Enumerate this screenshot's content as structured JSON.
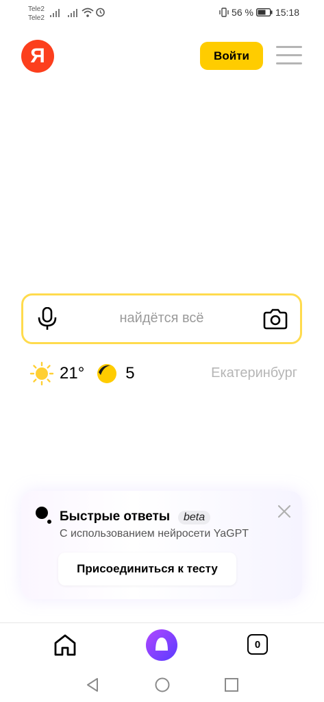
{
  "status_bar": {
    "carrier_1": "Tele2",
    "carrier_2": "Tele2",
    "battery_text": "56 %",
    "time": "15:18",
    "icons": [
      "signal-icon",
      "signal-icon",
      "wifi-icon",
      "alarm-icon",
      "vibrate-icon",
      "battery-icon"
    ]
  },
  "header": {
    "logo_letter": "Я",
    "login_label": "Войти",
    "brand_color": "#fc3f1d",
    "accent_color": "#ffcc00"
  },
  "search": {
    "placeholder": "найдётся всё",
    "border_color": "#ffdb4d"
  },
  "weather": {
    "temperature": "21°",
    "traffic_score": "5",
    "city": "Екатеринбург"
  },
  "quick_answers": {
    "title": "Быстрые ответы",
    "badge": "beta",
    "subtitle": "С использованием нейросети YaGPT",
    "join_label": "Присоединиться к тесту"
  },
  "bottom_bar": {
    "tabs_count": "0",
    "alice_color": "#8a3ffc"
  }
}
